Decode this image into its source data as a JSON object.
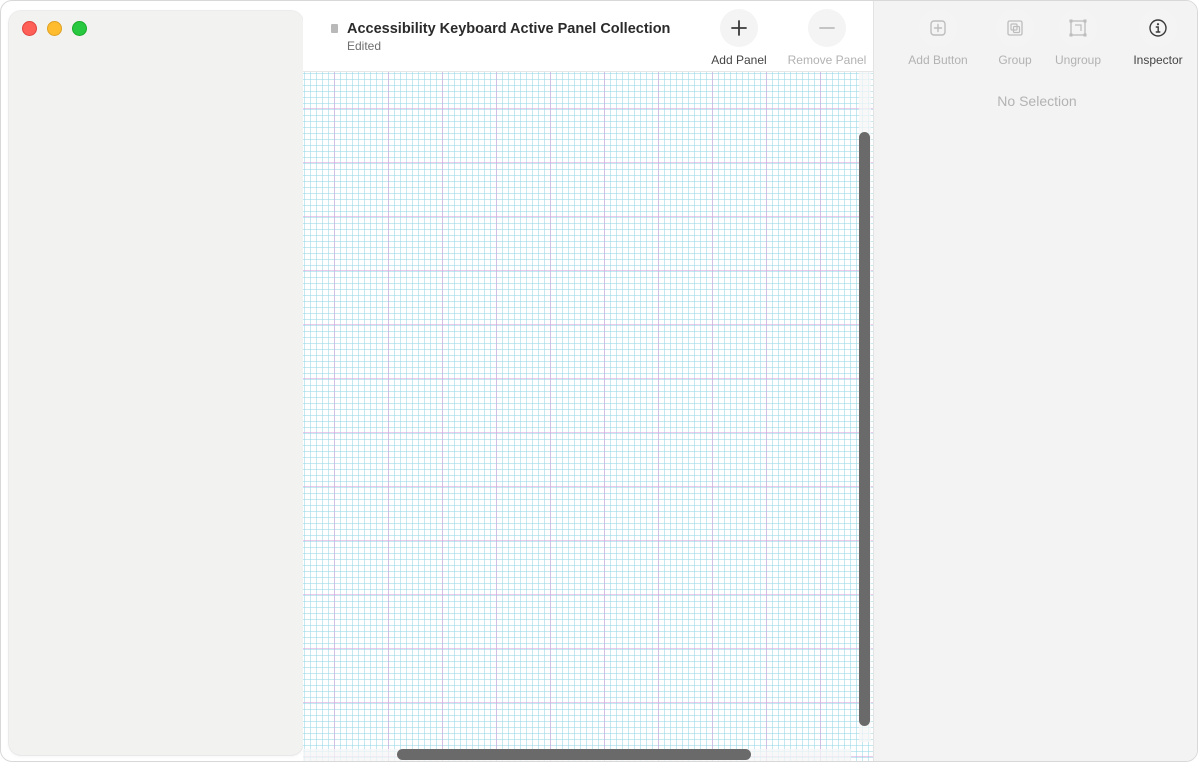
{
  "window": {
    "controls": [
      "close",
      "minimize",
      "zoom"
    ]
  },
  "document": {
    "title": "Accessibility Keyboard Active Panel Collection",
    "status": "Edited"
  },
  "toolbar": {
    "add_panel": {
      "label": "Add Panel",
      "icon": "plus-icon",
      "enabled": true
    },
    "remove_panel": {
      "label": "Remove Panel",
      "icon": "minus-icon",
      "enabled": false
    }
  },
  "inspector_toolbar": {
    "add_button": {
      "label": "Add Button",
      "icon": "plus-square-icon",
      "enabled": false
    },
    "group": {
      "label": "Group",
      "icon": "group-icon",
      "enabled": false
    },
    "ungroup": {
      "label": "Ungroup",
      "icon": "ungroup-icon",
      "enabled": false
    },
    "inspector": {
      "label": "Inspector",
      "icon": "info-icon",
      "enabled": true
    }
  },
  "inspector": {
    "empty_text": "No Selection"
  },
  "colors": {
    "close": "#fe5f57",
    "minimize": "#febc2e",
    "zoom": "#28c840",
    "grid_major": "#dca0dc",
    "grid_minor": "#96d7e6",
    "scroll_thumb": "#6a6a6a"
  }
}
